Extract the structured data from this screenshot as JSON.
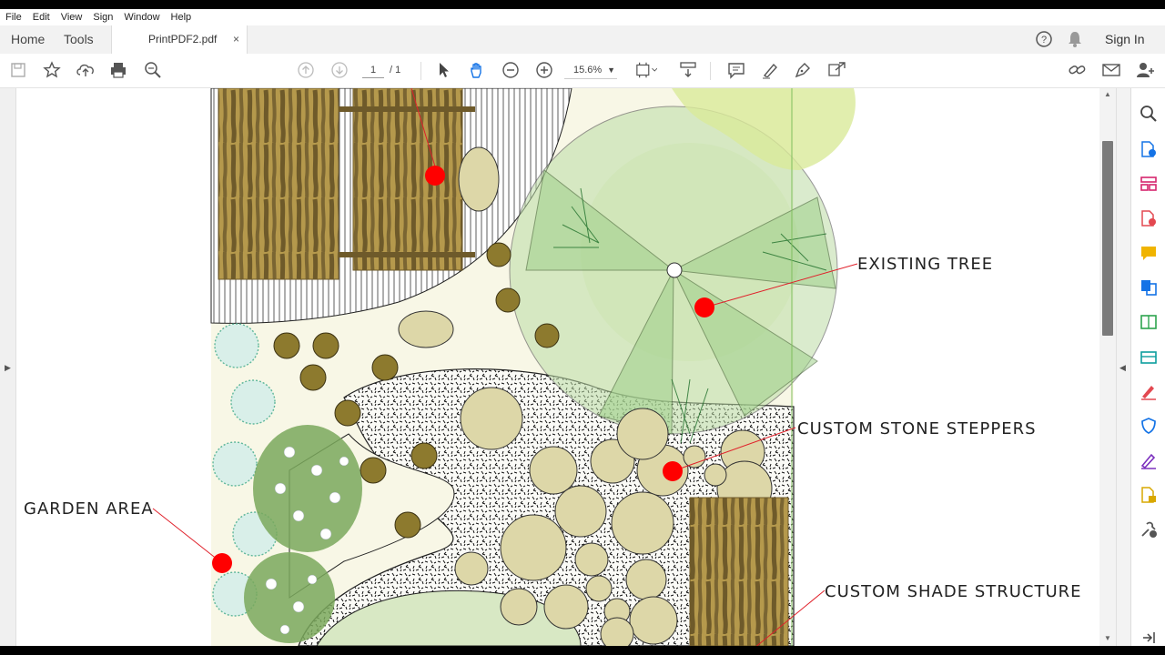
{
  "menu": [
    "File",
    "Edit",
    "View",
    "Sign",
    "Window",
    "Help"
  ],
  "tabs": {
    "home": "Home",
    "tools": "Tools",
    "document": "PrintPDF2.pdf",
    "close": "×"
  },
  "header_right": {
    "sign_in": "Sign In"
  },
  "toolbar": {
    "current_page": "1",
    "total_pages": "/ 1",
    "zoom": "15.6%"
  },
  "drawing": {
    "callouts": {
      "existing_tree": "EXISTING TREE",
      "custom_stone_steppers": "CUSTOM STONE STEPPERS",
      "garden_area": "GARDEN AREA",
      "custom_shade_structure": "CUSTOM SHADE STRUCTURE"
    },
    "marker_color": "#ff0000"
  },
  "right_panel_icons": [
    "search-icon",
    "export-pdf-icon",
    "organize-pages-icon",
    "create-pdf-icon",
    "comment-icon",
    "combine-files-icon",
    "edit-pdf-icon",
    "scan-icon",
    "fill-sign-icon",
    "protect-icon",
    "send-signature-icon",
    "send-track-icon",
    "more-tools-icon",
    "collapse-panel-icon"
  ],
  "colors": {
    "accent_blue": "#1473e6",
    "thatch": "#b5994c",
    "foliage": "#9fd08a",
    "gravel_bg": "#f7f5e7"
  }
}
